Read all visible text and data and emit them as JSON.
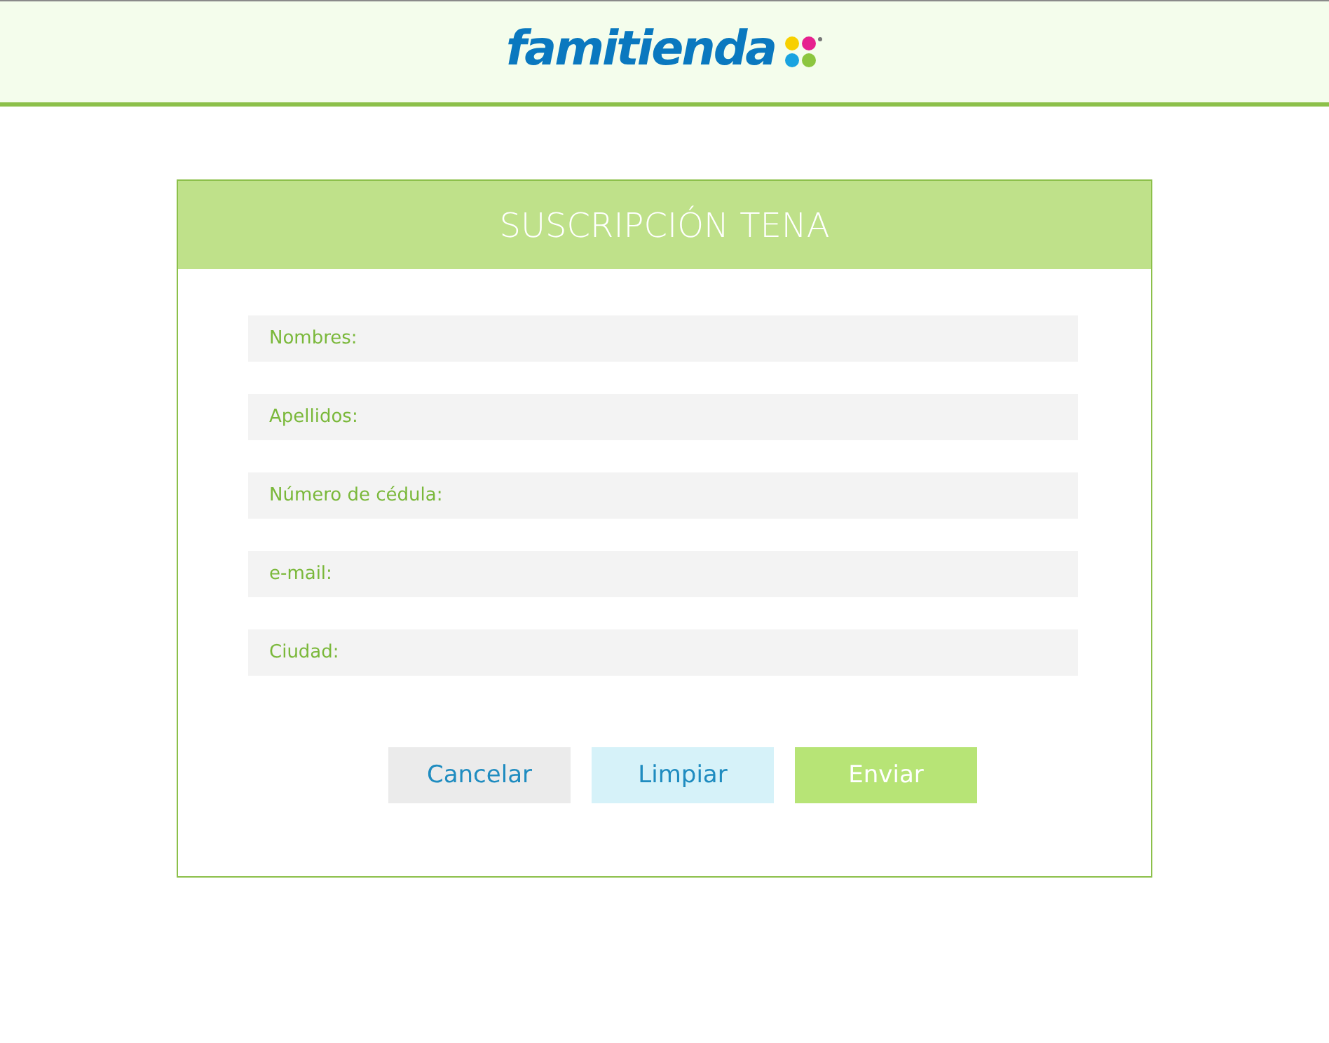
{
  "header": {
    "logo": "famitienda"
  },
  "form": {
    "title": "SUSCRIPCIÓN TENA",
    "fields": [
      {
        "placeholder": "Nombres:"
      },
      {
        "placeholder": "Apellidos:"
      },
      {
        "placeholder": "Número de cédula:"
      },
      {
        "placeholder": "e-mail:"
      },
      {
        "placeholder": "Ciudad:"
      }
    ],
    "buttons": [
      {
        "label": "Cancelar",
        "kind": "cancel"
      },
      {
        "label": "Limpiar",
        "kind": "reset"
      },
      {
        "label": "Enviar",
        "kind": "submit"
      }
    ]
  }
}
